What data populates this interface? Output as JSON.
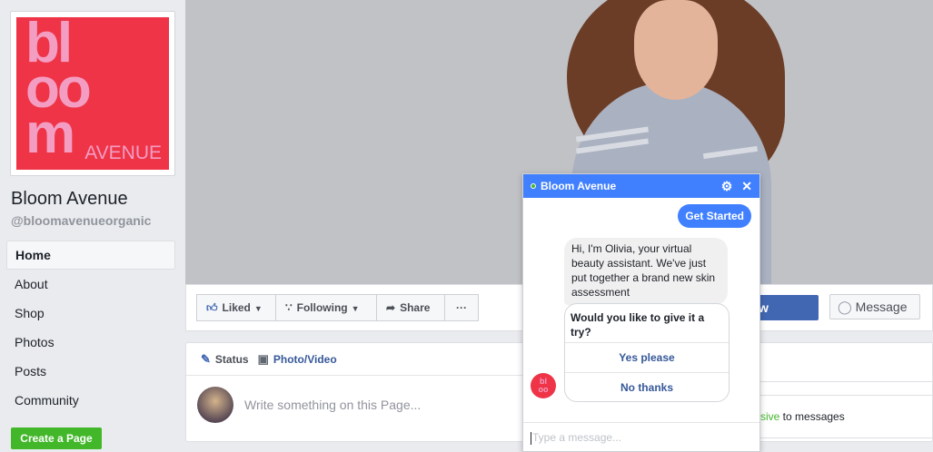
{
  "logo": {
    "line1": "bl",
    "line2": "oo",
    "line3": "m",
    "small": "AVENUE",
    "bg": "#ee3446",
    "fg": "#f39dc3"
  },
  "page": {
    "name": "Bloom Avenue",
    "handle": "@bloomavenueorganic"
  },
  "nav": {
    "items": [
      "Home",
      "About",
      "Shop",
      "Photos",
      "Posts",
      "Community"
    ],
    "active": "Home"
  },
  "create_page": "Create a Page",
  "actions": {
    "liked": "Liked",
    "following": "Following",
    "share": "Share",
    "more": "···",
    "blue_button_partial": "w",
    "message": "Message"
  },
  "composer": {
    "status": "Status",
    "photo_video": "Photo/Video",
    "placeholder": "Write something on this Page..."
  },
  "side": {
    "responsive_partial": "sive",
    "to_messages": " to messages"
  },
  "chat": {
    "title": "Bloom Avenue",
    "get_started": "Get Started",
    "bubble": "Hi, I'm Olivia, your virtual beauty assistant.  We've just put together a brand new skin assessment",
    "question": "Would you like to give it a try?",
    "options": [
      "Yes please",
      "No thanks"
    ],
    "input_placeholder": "Type a message..."
  },
  "colors": {
    "fb_blue": "#4267b2",
    "messenger_blue": "#4080ff",
    "green": "#42b72a"
  }
}
